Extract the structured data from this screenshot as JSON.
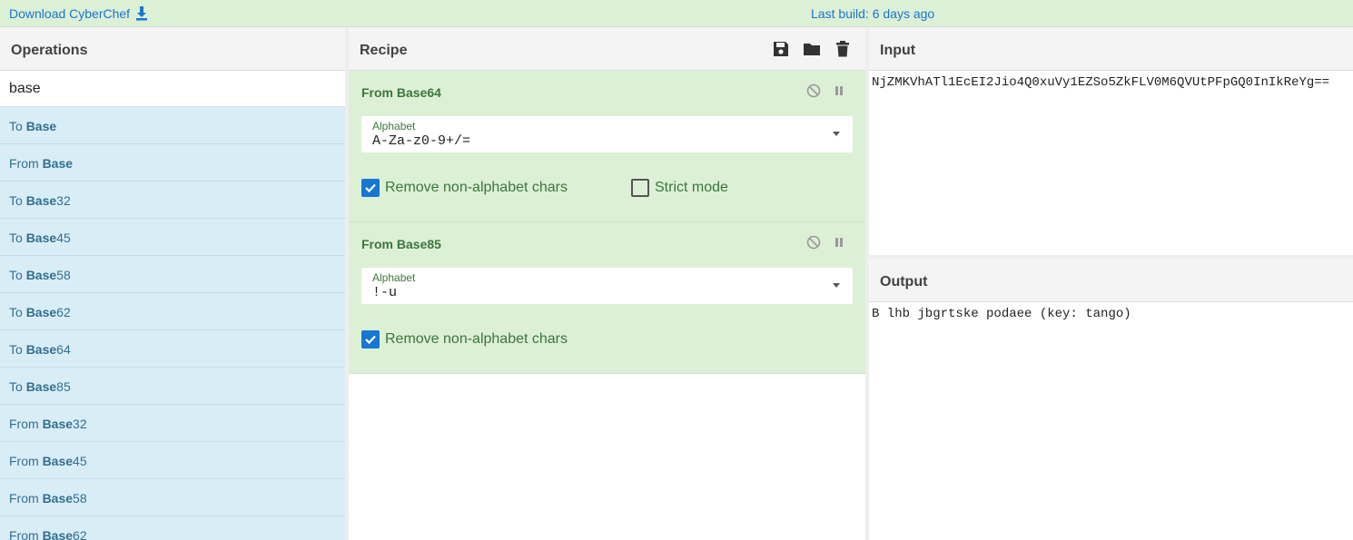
{
  "topbar": {
    "download_label": "Download CyberChef",
    "last_build": "Last build: 6 days ago"
  },
  "operations": {
    "title": "Operations",
    "search_value": "base",
    "items": [
      {
        "prefix": "To ",
        "bold": "Base",
        "suffix": ""
      },
      {
        "prefix": "From ",
        "bold": "Base",
        "suffix": ""
      },
      {
        "prefix": "To ",
        "bold": "Base",
        "suffix": "32"
      },
      {
        "prefix": "To ",
        "bold": "Base",
        "suffix": "45"
      },
      {
        "prefix": "To ",
        "bold": "Base",
        "suffix": "58"
      },
      {
        "prefix": "To ",
        "bold": "Base",
        "suffix": "62"
      },
      {
        "prefix": "To ",
        "bold": "Base",
        "suffix": "64"
      },
      {
        "prefix": "To ",
        "bold": "Base",
        "suffix": "85"
      },
      {
        "prefix": "From ",
        "bold": "Base",
        "suffix": "32"
      },
      {
        "prefix": "From ",
        "bold": "Base",
        "suffix": "45"
      },
      {
        "prefix": "From ",
        "bold": "Base",
        "suffix": "58"
      },
      {
        "prefix": "From ",
        "bold": "Base",
        "suffix": "62"
      }
    ]
  },
  "recipe": {
    "title": "Recipe",
    "icons": [
      "save-icon",
      "folder-icon",
      "trash-icon"
    ],
    "ops": [
      {
        "title": "From Base64",
        "alphabet_label": "Alphabet",
        "alphabet_value": "A-Za-z0-9+/=",
        "remove_label": "Remove non-alphabet chars",
        "remove_checked": true,
        "strict_label": "Strict mode",
        "strict_checked": false
      },
      {
        "title": "From Base85",
        "alphabet_label": "Alphabet",
        "alphabet_value": "!-u",
        "remove_label": "Remove non-alphabet chars",
        "remove_checked": true
      }
    ]
  },
  "input": {
    "title": "Input",
    "text": "NjZMKVhATl1EcEI2Jio4Q0xuVy1EZSo5ZkFLV0M6QVUtPFpGQ0InIkReYg=="
  },
  "output": {
    "title": "Output",
    "text": "B lhb jbgrtske podaee (key: tango)"
  },
  "colors": {
    "accent": "#1976d2",
    "recipe_bg": "#dcf0d6",
    "op_bg": "#d9edf7",
    "op_text": "#31708f",
    "green_text": "#3c763d"
  }
}
